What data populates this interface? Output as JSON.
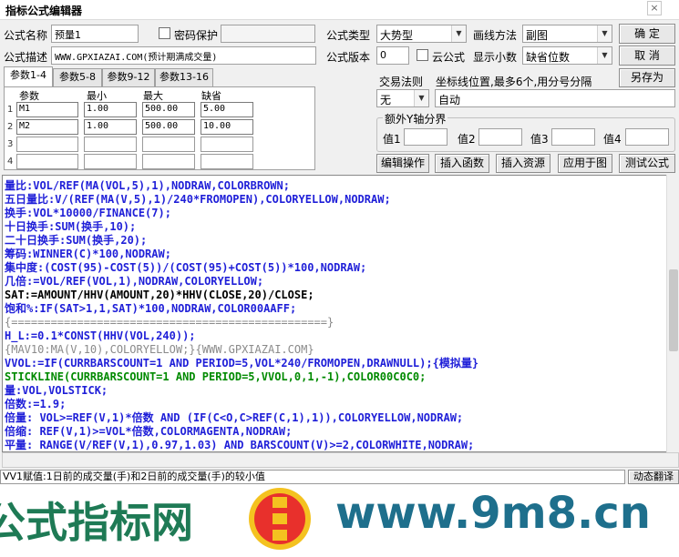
{
  "window": {
    "title": "指标公式编辑器",
    "close_glyph": "×"
  },
  "form": {
    "name_label": "公式名称",
    "name_value": "预量1",
    "password_label": "密码保护",
    "desc_label": "公式描述",
    "desc_value": "WWW.GPXIAZAI.COM(预计期满成交量)",
    "type_label": "公式类型",
    "type_value": "大势型",
    "draw_label": "画线方法",
    "draw_value": "副图",
    "version_label": "公式版本",
    "version_value": "0",
    "cloud_label": "云公式",
    "decimal_label": "显示小数",
    "decimal_value": "缺省位数",
    "trade_rule_label": "交易法则",
    "trade_rule_value": "无",
    "coord_label": "坐标线位置,最多6个,用分号分隔",
    "coord_value": "自动",
    "yaxis_group_label": "额外Y轴分界",
    "yaxis_labels": [
      "值1",
      "值2",
      "值3",
      "值4"
    ]
  },
  "buttons": {
    "ok": "确  定",
    "cancel": "取  消",
    "save_as": "另存为",
    "edit_op": "编辑操作",
    "insert_func": "插入函数",
    "insert_res": "插入资源",
    "apply_chart": "应用于图",
    "test_formula": "测试公式"
  },
  "tabs": [
    "参数1-4",
    "参数5-8",
    "参数9-12",
    "参数13-16"
  ],
  "params": {
    "headers": [
      "参数",
      "最小",
      "最大",
      "缺省"
    ],
    "rows": [
      {
        "n": "1",
        "name": "M1",
        "min": "1.00",
        "max": "500.00",
        "def": "5.00"
      },
      {
        "n": "2",
        "name": "M2",
        "min": "1.00",
        "max": "500.00",
        "def": "10.00"
      },
      {
        "n": "3",
        "name": "",
        "min": "",
        "max": "",
        "def": ""
      },
      {
        "n": "4",
        "name": "",
        "min": "",
        "max": "",
        "def": ""
      }
    ]
  },
  "code_lines": [
    "量比:VOL/REF(MA(VOL,5),1),NODRAW,COLORBROWN;",
    "五日量比:V/(REF(MA(V,5),1)/240*FROMOPEN),COLORYELLOW,NODRAW;",
    "换手:VOL*10000/FINANCE(7);",
    "十日换手:SUM(换手,10);",
    "二十日换手:SUM(换手,20);",
    "筹码:WINNER(C)*100,NODRAW;",
    "集中度:(COST(95)-COST(5))/(COST(95)+COST(5))*100,NODRAW;",
    "几倍:=VOL/REF(VOL,1),NODRAW,COLORYELLOW;",
    "SAT:=AMOUNT/HHV(AMOUNT,20)*HHV(CLOSE,20)/CLOSE;",
    "饱和%:IF(SAT>1,1,SAT)*100,NODRAW,COLOR00AAFF;",
    "{================================================}",
    "H_L:=0.1*CONST(HHV(VOL,240));",
    "{MAV10:MA(V,10),COLORYELLOW;}{WWW.GPXIAZAI.COM}",
    "VVOL:=IF(CURRBARSCOUNT=1 AND PERIOD=5,VOL*240/FROMOPEN,DRAWNULL);{模拟量}",
    "STICKLINE(CURRBARSCOUNT=1 AND PERIOD=5,VVOL,0,1,-1),COLOR00C0C0;",
    "量:VOL,VOLSTICK;",
    "倍数:=1.9;",
    "倍量: VOL>=REF(V,1)*倍数 AND (IF(C<O,C>REF(C,1),1)),COLORYELLOW,NODRAW;",
    "倍缩: REF(V,1)>=VOL*倍数,COLORMAGENTA,NODRAW;",
    "平量: RANGE(V/REF(V,1),0.97,1.03) AND BARSCOUNT(V)>=2,COLORWHITE,NODRAW;"
  ],
  "status": {
    "text": "VV1赋值:1日前的成交量(手)和2日前的成交量(手)的较小值",
    "button": "动态翻译"
  },
  "banner": {
    "left_text": "公式指标网",
    "logo_text": "公式指标网",
    "logo_url": "www.9m8.cn",
    "right_text": "www.9m8.cn"
  },
  "colors": {
    "banner_green": "#1e7a55",
    "banner_blue": "#1e6f8c",
    "code_blue": "#1f1fd8",
    "code_magenta": "#d000d0"
  }
}
